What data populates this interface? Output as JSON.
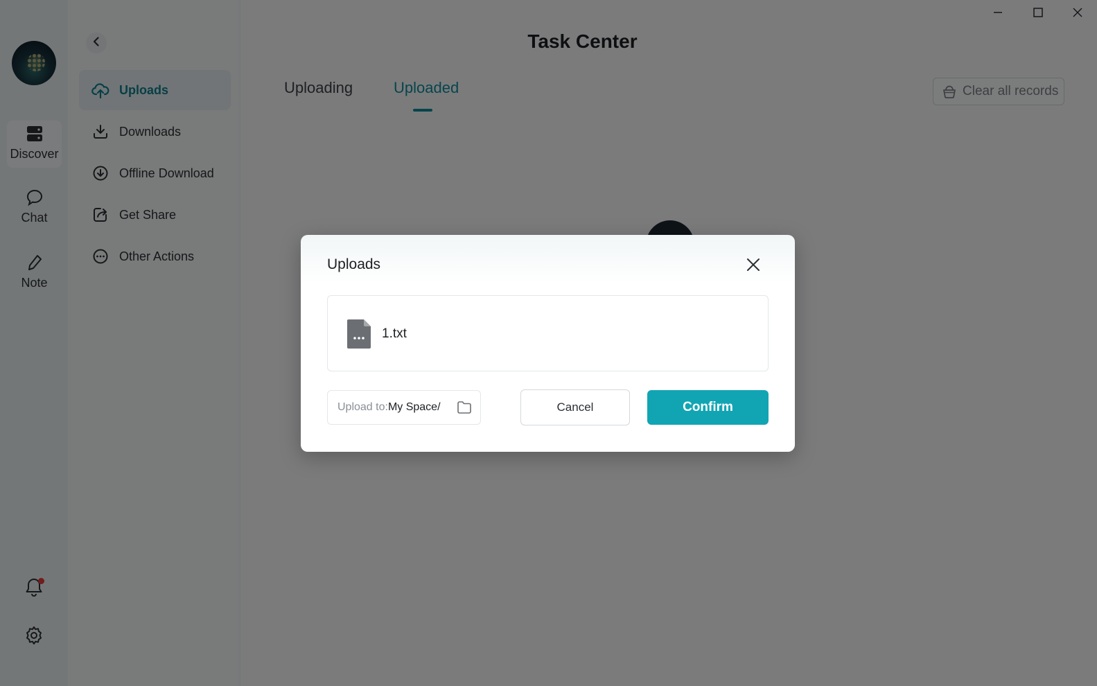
{
  "rail": {
    "items": [
      {
        "label": "Discover",
        "icon": "discover-icon"
      },
      {
        "label": "Chat",
        "icon": "chat-icon"
      },
      {
        "label": "Note",
        "icon": "note-icon"
      }
    ],
    "bottom_icons": [
      "bell-icon",
      "gear-icon"
    ]
  },
  "sidebar": {
    "items": [
      {
        "label": "Uploads",
        "icon": "upload-cloud-icon",
        "active": true
      },
      {
        "label": "Downloads",
        "icon": "download-icon"
      },
      {
        "label": "Offline Download",
        "icon": "offline-download-icon"
      },
      {
        "label": "Get Share",
        "icon": "share-icon"
      },
      {
        "label": "Other Actions",
        "icon": "more-icon"
      }
    ]
  },
  "header": {
    "title": "Task Center"
  },
  "tabs": [
    {
      "label": "Uploading"
    },
    {
      "label": "Uploaded",
      "active": true
    }
  ],
  "clear_records": {
    "label": "Clear all records"
  },
  "dialog": {
    "title": "Uploads",
    "file": {
      "name": "1.txt"
    },
    "upload_to": {
      "prefix": "Upload to:",
      "path": "My Space/"
    },
    "cancel_label": "Cancel",
    "confirm_label": "Confirm"
  },
  "colors": {
    "accent": "#11a5b4",
    "accent_text": "#0f8a98",
    "badge": "#e03a3a"
  }
}
